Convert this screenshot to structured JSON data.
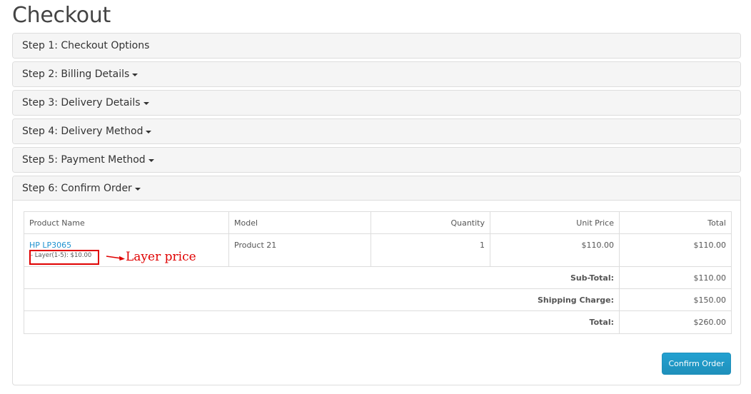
{
  "page": {
    "title": "Checkout"
  },
  "steps": [
    {
      "label": "Step 1: Checkout Options",
      "has_caret": false
    },
    {
      "label": "Step 2: Billing Details",
      "has_caret": true
    },
    {
      "label": "Step 3: Delivery Details",
      "has_caret": true
    },
    {
      "label": "Step 4: Delivery Method",
      "has_caret": true
    },
    {
      "label": "Step 5: Payment Method",
      "has_caret": true
    },
    {
      "label": "Step 6: Confirm Order",
      "has_caret": true
    }
  ],
  "order_table": {
    "headers": {
      "product_name": "Product Name",
      "model": "Model",
      "quantity": "Quantity",
      "unit_price": "Unit Price",
      "total": "Total"
    },
    "products": [
      {
        "name": "HP LP3065",
        "option": "- Layer(1-5): $10.00",
        "model": "Product 21",
        "quantity": "1",
        "unit_price": "$110.00",
        "total": "$110.00"
      }
    ],
    "totals": [
      {
        "label": "Sub-Total:",
        "value": "$110.00"
      },
      {
        "label": "Shipping Charge:",
        "value": "$150.00"
      },
      {
        "label": "Total:",
        "value": "$260.00"
      }
    ]
  },
  "annotation": {
    "label": "Layer price",
    "color": "#e00000"
  },
  "confirm_button": {
    "label": "Confirm Order"
  },
  "colors": {
    "link": "#1e91cf",
    "button": "#229ac8",
    "panel_heading_bg": "#f5f5f5",
    "border": "#dddddd"
  }
}
